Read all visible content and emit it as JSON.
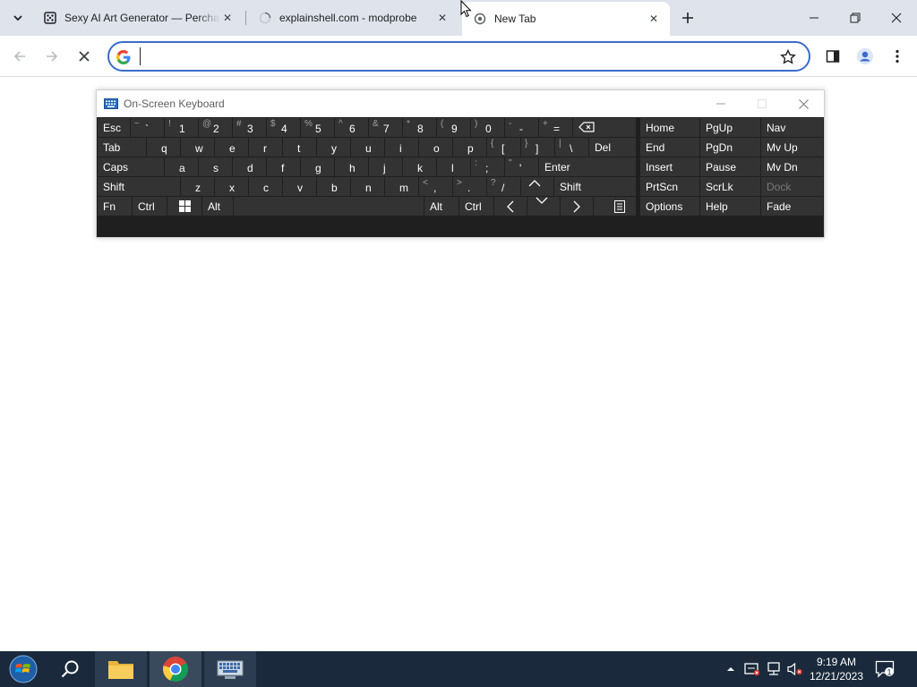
{
  "browser": {
    "tabs": [
      {
        "title": "Sexy AI Art Generator — Percha",
        "favicon": "dice-icon"
      },
      {
        "title": "explainshell.com - modprobe",
        "favicon": "loading-spinner-icon"
      },
      {
        "title": "New Tab",
        "favicon": "chrome-loading-icon",
        "active": true
      }
    ],
    "omnibox": {
      "value": "",
      "placeholder": ""
    }
  },
  "osk": {
    "title": "On-Screen Keyboard",
    "keys": {
      "esc": "Esc",
      "tab": "Tab",
      "caps": "Caps",
      "shift_l": "Shift",
      "fn": "Fn",
      "ctrl_l": "Ctrl",
      "alt_l": "Alt",
      "alt_r": "Alt",
      "ctrl_r": "Ctrl",
      "del": "Del",
      "enter": "Enter",
      "shift_r": "Shift",
      "home": "Home",
      "pgup": "PgUp",
      "nav": "Nav",
      "end": "End",
      "pgdn": "PgDn",
      "mvup": "Mv Up",
      "insert": "Insert",
      "pause": "Pause",
      "mvdn": "Mv Dn",
      "prtscn": "PrtScn",
      "scrlk": "ScrLk",
      "dock": "Dock",
      "options": "Options",
      "help": "Help",
      "fade": "Fade"
    },
    "number_row": [
      {
        "shift": "~",
        "main": "`"
      },
      {
        "shift": "!",
        "main": "1"
      },
      {
        "shift": "@",
        "main": "2"
      },
      {
        "shift": "#",
        "main": "3"
      },
      {
        "shift": "$",
        "main": "4"
      },
      {
        "shift": "%",
        "main": "5"
      },
      {
        "shift": "^",
        "main": "6"
      },
      {
        "shift": "&",
        "main": "7"
      },
      {
        "shift": "*",
        "main": "8"
      },
      {
        "shift": "(",
        "main": "9"
      },
      {
        "shift": ")",
        "main": "0"
      },
      {
        "shift": "-",
        "main": "-"
      },
      {
        "shift": "+",
        "main": "="
      }
    ],
    "row_q": [
      "q",
      "w",
      "e",
      "r",
      "t",
      "y",
      "u",
      "i",
      "o",
      "p"
    ],
    "row_q_sym": [
      {
        "shift": "{",
        "main": "["
      },
      {
        "shift": "}",
        "main": "]"
      },
      {
        "shift": "|",
        "main": "\\"
      }
    ],
    "row_a": [
      "a",
      "s",
      "d",
      "f",
      "g",
      "h",
      "j",
      "k",
      "l"
    ],
    "row_a_sym": [
      {
        "shift": ":",
        "main": ";"
      },
      {
        "shift": "\"",
        "main": "'"
      }
    ],
    "row_z": [
      "z",
      "x",
      "c",
      "v",
      "b",
      "n",
      "m"
    ],
    "row_z_sym": [
      {
        "shift": "<",
        "main": ","
      },
      {
        "shift": ">",
        "main": "."
      },
      {
        "shift": "?",
        "main": "/"
      }
    ]
  },
  "taskbar": {
    "time": "9:19 AM",
    "date": "12/21/2023",
    "apps": [
      "file-explorer-icon",
      "chrome-icon",
      "on-screen-keyboard-icon"
    ]
  },
  "colors": {
    "accent": "#3b6ccc",
    "osk_bg": "#1f1f1f",
    "osk_key": "#333333",
    "taskbar": "#1a2a3c"
  }
}
